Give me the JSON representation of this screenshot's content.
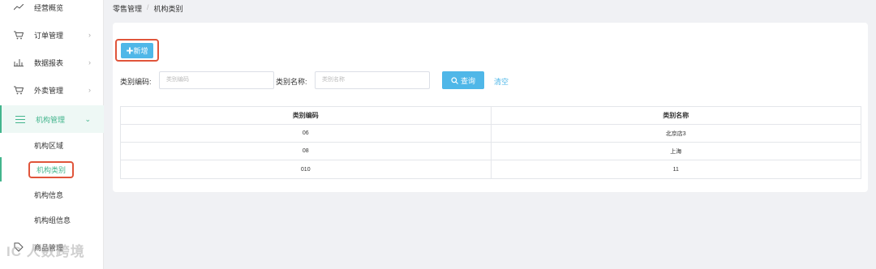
{
  "sidebar": {
    "items": [
      {
        "label": "经营概览",
        "icon": "trend-line-icon",
        "glyph": "〰",
        "has_arrow": false
      },
      {
        "label": "订单管理",
        "icon": "cart-icon",
        "glyph": "🛒",
        "has_arrow": true
      },
      {
        "label": "数据报表",
        "icon": "bar-chart-icon",
        "glyph": "▥",
        "has_arrow": true
      },
      {
        "label": "外卖管理",
        "icon": "cart-icon",
        "glyph": "🛒",
        "has_arrow": true
      },
      {
        "label": "机构管理",
        "icon": "menu-lines-icon",
        "glyph": "☰",
        "has_arrow": true,
        "expanded": true
      }
    ],
    "chevron_right": "›",
    "chevron_down": "⌄",
    "sub_items": [
      {
        "label": "机构区域"
      },
      {
        "label": "机构类别",
        "selected": true
      },
      {
        "label": "机构信息"
      },
      {
        "label": "机构组信息"
      }
    ],
    "partial_item": {
      "label": "商品管理",
      "icon": "tag-icon"
    },
    "accent_color": "#43b58d"
  },
  "watermark": "IC 人数跨境",
  "breadcrumb": {
    "root": "零售管理",
    "separator": "/",
    "current": "机构类别"
  },
  "toolbar": {
    "add_label": "✚新增"
  },
  "filters": {
    "code_label": "类别编码:",
    "code_placeholder": "类别编码",
    "name_label": "类别名称:",
    "name_placeholder": "类别名称",
    "search_label": "查询",
    "clear_label": "清空"
  },
  "table": {
    "columns": [
      "类别编码",
      "类别名称"
    ],
    "rows": [
      [
        "06",
        "北京店3"
      ],
      [
        "08",
        "上海"
      ],
      [
        "010",
        "11"
      ]
    ]
  },
  "colors": {
    "primary": "#4fb7e8",
    "highlight": "#e0553b"
  }
}
